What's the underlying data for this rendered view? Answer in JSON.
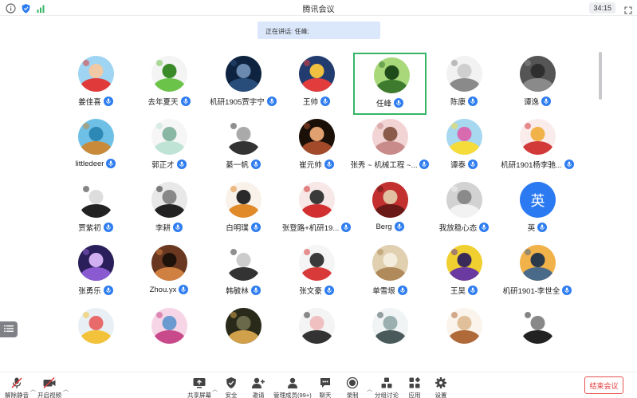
{
  "window": {
    "title": "腾讯会议",
    "timer": "34:15"
  },
  "speaking_banner": "正在讲话: 任峰;",
  "participants": [
    {
      "name": "姜佳喜",
      "avatar": "cartoon-boy-red-cap"
    },
    {
      "name": "去年夏天",
      "avatar": "peashooter-plant"
    },
    {
      "name": "机研1905贾宇宁",
      "avatar": "dark-blue-scene"
    },
    {
      "name": "王帅",
      "avatar": "blue-cartoon-badge"
    },
    {
      "name": "任峰",
      "avatar": "green-forest",
      "active": true
    },
    {
      "name": "陈康",
      "avatar": "grey-bear-figure"
    },
    {
      "name": "谭逸",
      "avatar": "dark-grey-photo"
    },
    {
      "name": "littledeer",
      "avatar": "blue-sky-pier"
    },
    {
      "name": "郭正才",
      "avatar": "anime-sketch"
    },
    {
      "name": "綦一帆",
      "avatar": "zebra-sketch"
    },
    {
      "name": "崔元帅",
      "avatar": "dark-portrait"
    },
    {
      "name": "张秀 ~ 机械工程 ~...",
      "avatar": "pink-girl"
    },
    {
      "name": "谭泰",
      "avatar": "spongebob-rabbit"
    },
    {
      "name": "机研1901杨李驰...",
      "avatar": "cartoon-badge-red"
    },
    {
      "name": "贾紫初",
      "avatar": "blob-face-sketch"
    },
    {
      "name": "李耕",
      "avatar": "bw-portrait"
    },
    {
      "name": "白明璞",
      "avatar": "tiger-cartoon"
    },
    {
      "name": "张登路+机研19...",
      "avatar": "red-cartoon"
    },
    {
      "name": "Berg",
      "avatar": "red-photo"
    },
    {
      "name": "我放稳心态",
      "avatar": "puppy-photo"
    },
    {
      "name": "英",
      "avatar": "letter",
      "letter": "英"
    },
    {
      "name": "张勇乐",
      "avatar": "purple-trees"
    },
    {
      "name": "Zhou.yx",
      "avatar": "dusk-figure"
    },
    {
      "name": "韩毓林",
      "avatar": "line-sketch"
    },
    {
      "name": "张文豪",
      "avatar": "red-anime"
    },
    {
      "name": "单雪垠",
      "avatar": "cat-photo"
    },
    {
      "name": "王昊",
      "avatar": "purple-character"
    },
    {
      "name": "机研1901-李世全",
      "avatar": "sunset-landscape"
    },
    {
      "name": "",
      "avatar": "flowers"
    },
    {
      "name": "",
      "avatar": "pink-cartoon"
    },
    {
      "name": "",
      "avatar": "night-street"
    },
    {
      "name": "",
      "avatar": "sad-face-box"
    },
    {
      "name": "",
      "avatar": "figure-sketch"
    },
    {
      "name": "",
      "avatar": "cats-sketch"
    },
    {
      "name": "",
      "avatar": "pixel-face"
    }
  ],
  "toolbar": {
    "unmute": "解除静音",
    "start_video": "开启视频",
    "share_screen": "共享屏幕",
    "security": "安全",
    "invite": "邀请",
    "manage_members": "管理成员(99+)",
    "chat": "聊天",
    "record": "录制",
    "breakout": "分组讨论",
    "apps": "应用",
    "settings": "设置",
    "end_meeting": "结束会议"
  },
  "colors": {
    "accent": "#2d7cf0",
    "active_border": "#35b666",
    "end_red": "#e53a3a",
    "banner": "#dbe8fb"
  }
}
